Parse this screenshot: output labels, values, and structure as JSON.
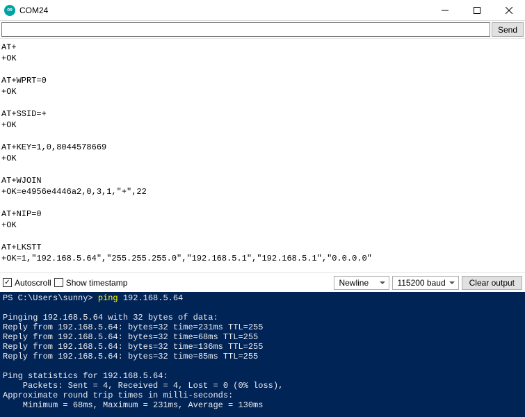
{
  "window": {
    "title": "COM24"
  },
  "input_row": {
    "value": "",
    "send_label": "Send"
  },
  "serial_output": [
    "AT+",
    "+OK",
    "",
    "AT+WPRT=0",
    "+OK",
    "",
    "AT+SSID=+",
    "+OK",
    "",
    "AT+KEY=1,0,8044578669",
    "+OK",
    "",
    "AT+WJOIN",
    "+OK=e4956e4446a2,0,3,1,\"+\",22",
    "",
    "AT+NIP=0",
    "+OK",
    "",
    "AT+LKSTT",
    "+OK=1,\"192.168.5.64\",\"255.255.255.0\",\"192.168.5.1\",\"192.168.5.1\",\"0.0.0.0\"",
    ""
  ],
  "bottombar": {
    "autoscroll": {
      "label": "Autoscroll",
      "checked": true
    },
    "timestamp": {
      "label": "Show timestamp",
      "checked": false
    },
    "lineending": "Newline",
    "baud": "115200 baud",
    "clear_label": "Clear output"
  },
  "terminal": {
    "prompt": "PS C:\\Users\\sunny>",
    "command": "ping",
    "arg": "192.168.5.64",
    "body": [
      "",
      "Pinging 192.168.5.64 with 32 bytes of data:",
      "Reply from 192.168.5.64: bytes=32 time=231ms TTL=255",
      "Reply from 192.168.5.64: bytes=32 time=68ms TTL=255",
      "Reply from 192.168.5.64: bytes=32 time=136ms TTL=255",
      "Reply from 192.168.5.64: bytes=32 time=85ms TTL=255",
      "",
      "Ping statistics for 192.168.5.64:",
      "    Packets: Sent = 4, Received = 4, Lost = 0 (0% loss),",
      "Approximate round trip times in milli-seconds:",
      "    Minimum = 68ms, Maximum = 231ms, Average = 130ms"
    ]
  }
}
